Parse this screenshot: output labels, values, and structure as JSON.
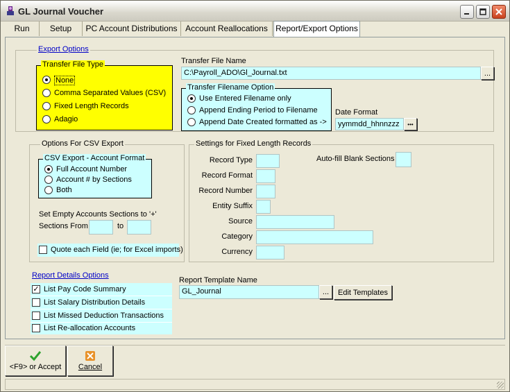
{
  "window": {
    "title": "GL Journal Voucher"
  },
  "tabs": [
    {
      "label": "Run"
    },
    {
      "label": "Setup"
    },
    {
      "label": "PC Account Distributions"
    },
    {
      "label": "Account Reallocations"
    },
    {
      "label": "Report/Export Options"
    }
  ],
  "export_options": {
    "title": "Export Options",
    "transfer_file_type": {
      "title": "Transfer File Type",
      "options": [
        {
          "label": "None",
          "selected": true
        },
        {
          "label": "Comma Separated Values (CSV)",
          "selected": false
        },
        {
          "label": "Fixed Length Records",
          "selected": false
        },
        {
          "label": "Adagio",
          "selected": false
        }
      ]
    },
    "transfer_file_name": {
      "label": "Transfer File Name",
      "value": "C:\\Payroll_ADO\\Gl_Journal.txt",
      "browse": "..."
    },
    "transfer_filename_option": {
      "title": "Transfer Filename Option",
      "options": [
        {
          "label": "Use Entered Filename only",
          "selected": true
        },
        {
          "label": "Append Ending Period to Filename",
          "selected": false
        },
        {
          "label": "Append Date Created formatted as ->",
          "selected": false
        }
      ]
    },
    "date_format": {
      "label": "Date Format",
      "value": "yymmdd_hhnnzzz",
      "browse": "•••"
    }
  },
  "csv_export": {
    "title": "Options For CSV Export",
    "account_format": {
      "title": "CSV Export - Account Format",
      "options": [
        {
          "label": "Full Account Number",
          "selected": true
        },
        {
          "label": "Account # by Sections",
          "selected": false
        },
        {
          "label": "Both",
          "selected": false
        }
      ]
    },
    "empty_sections_label": "Set Empty Accounts Sections to '+'",
    "sections_from_label": "Sections From",
    "sections_from_value": "",
    "to_label": "to",
    "to_value": "",
    "quote_field": {
      "label": "Quote each Field (ie; for Excel imports)",
      "checked": false
    }
  },
  "fixed_length": {
    "title": "Settings for Fixed Length Records",
    "fields": [
      {
        "label": "Record Type",
        "value": ""
      },
      {
        "label": "Record Format",
        "value": ""
      },
      {
        "label": "Record Number",
        "value": ""
      },
      {
        "label": "Entity Suffix",
        "value": ""
      },
      {
        "label": "Source",
        "value": ""
      },
      {
        "label": "Category",
        "value": ""
      },
      {
        "label": "Currency",
        "value": ""
      }
    ],
    "autofill_label": "Auto-fill Blank Sections",
    "autofill_value": ""
  },
  "report_details": {
    "title": "Report Details Options",
    "options": [
      {
        "label": "List Pay Code Summary",
        "checked": true
      },
      {
        "label": "List Salary Distribution Details",
        "checked": false
      },
      {
        "label": "List Missed Deduction Transactions",
        "checked": false
      },
      {
        "label": "List Re-allocation Accounts",
        "checked": false
      }
    ],
    "template_label": "Report Template Name",
    "template_value": "GL_Journal",
    "template_browse": "...",
    "edit_templates": "Edit Templates"
  },
  "buttons": {
    "accept": "<F9> or Accept",
    "cancel": "Cancel"
  },
  "colors": {
    "yellow_group": "#ffff00",
    "field_bg": "#ccffff",
    "link": "#0000c8",
    "accept_icon": "#2ea32e",
    "cancel_icon": "#e8922a"
  }
}
